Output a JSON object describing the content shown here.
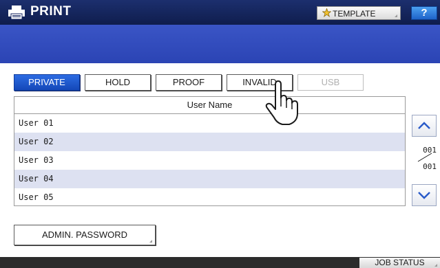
{
  "title_bar": {
    "title": "PRINT",
    "template_label": "TEMPLATE",
    "help_label": "?"
  },
  "tabs": [
    {
      "label": "PRIVATE",
      "state": "selected"
    },
    {
      "label": "HOLD",
      "state": "normal"
    },
    {
      "label": "PROOF",
      "state": "normal"
    },
    {
      "label": "INVALID",
      "state": "normal"
    },
    {
      "label": "USB",
      "state": "disabled"
    }
  ],
  "list": {
    "header": "User Name",
    "rows": [
      "User 01",
      "User 02",
      "User 03",
      "User 04",
      "User 05"
    ]
  },
  "pagination": {
    "current": "001",
    "total": "001"
  },
  "admin_password_label": "ADMIN. PASSWORD",
  "job_status_label": "JOB STATUS",
  "colors": {
    "title_bar": "#142560",
    "subheader": "#3350bf",
    "tab_selected": "#1e5ad0",
    "row_alt": "#dde1f1",
    "help_button": "#2f7de0"
  },
  "icons": {
    "print": "printer-icon",
    "template": "star-icon",
    "scroll_up": "chevron-up-icon",
    "scroll_down": "chevron-down-icon",
    "cursor": "pointing-hand-icon"
  }
}
